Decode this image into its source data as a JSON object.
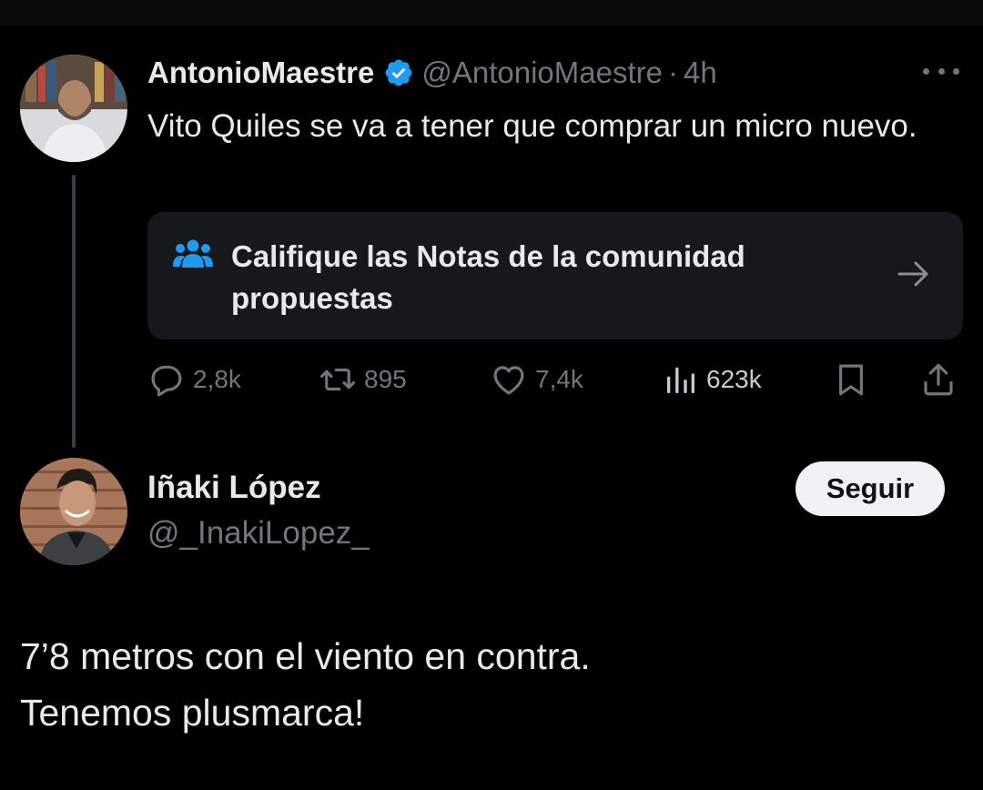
{
  "tweet1": {
    "author_name": "AntonioMaestre",
    "handle": "@AntonioMaestre",
    "separator": "·",
    "time": "4h",
    "text": "Vito Quiles se va a tener que comprar un micro nuevo.",
    "community_notes": {
      "label": "Califique las Notas de la comunidad propuestas"
    },
    "actions": {
      "replies": "2,8k",
      "reposts": "895",
      "likes": "7,4k",
      "views": "623k"
    }
  },
  "tweet2": {
    "author_name": "Iñaki López",
    "handle": "@_InakiLopez_",
    "follow_label": "Seguir",
    "text_line1": "7’8 metros con el viento en contra.",
    "text_line2": "Tenemos plusmarca!"
  },
  "colors": {
    "background": "#000000",
    "primary_text": "#e7e9ea",
    "secondary_text": "#71767b",
    "verified_blue": "#1d9bf0",
    "card_bg": "#16181c"
  }
}
